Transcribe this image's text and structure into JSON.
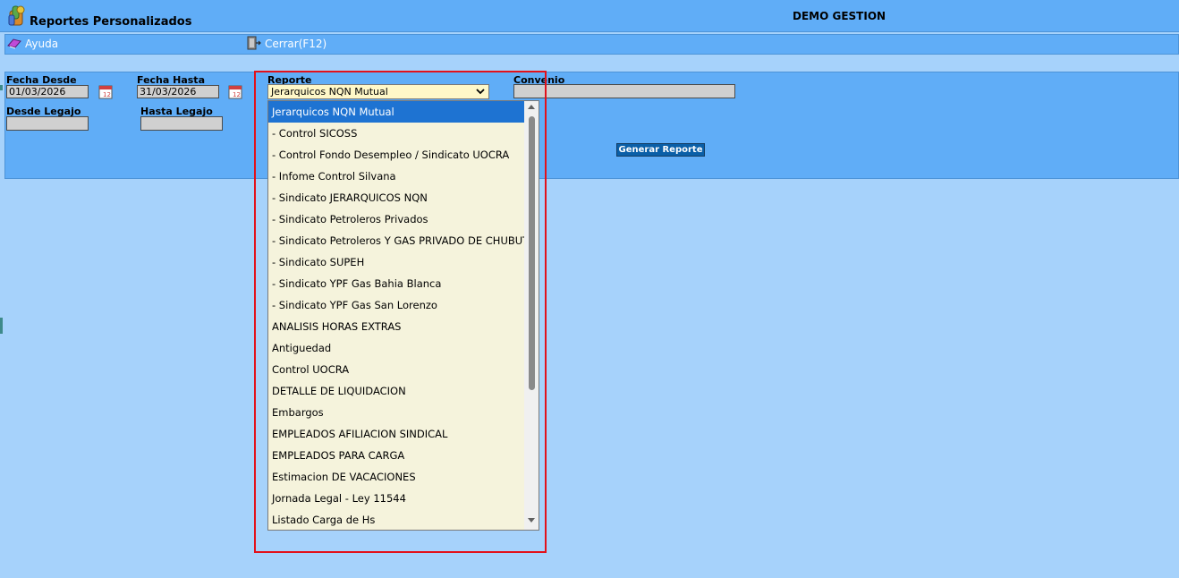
{
  "header": {
    "title": "Reportes Personalizados",
    "company": "DEMO GESTION"
  },
  "menu": {
    "ayuda": "Ayuda",
    "cerrar": "Cerrar(F12)"
  },
  "form": {
    "fecha_desde_label": "Fecha Desde",
    "fecha_desde_value": "01/03/2026",
    "fecha_hasta_label": "Fecha Hasta",
    "fecha_hasta_value": "31/03/2026",
    "reporte_label": "Reporte",
    "reporte_value": "Jerarquicos NQN Mutual",
    "convenio_label": "Convenio",
    "convenio_value": "",
    "desde_legajo_label": "Desde Legajo",
    "desde_legajo_value": "",
    "hasta_legajo_label": "Hasta Legajo",
    "hasta_legajo_value": "",
    "generar_label": "Generar Reporte"
  },
  "dropdown": {
    "selected_index": 0,
    "options": [
      "Jerarquicos NQN Mutual",
      "- Control SICOSS",
      "- Control Fondo Desempleo / Sindicato UOCRA",
      "- Infome Control Silvana",
      "- Sindicato JERARQUICOS NQN",
      "- Sindicato Petroleros Privados",
      "- Sindicato Petroleros Y GAS PRIVADO DE CHUBUT",
      "- Sindicato SUPEH",
      "- Sindicato YPF Gas Bahia Blanca",
      "- Sindicato YPF Gas San Lorenzo",
      "ANALISIS HORAS EXTRAS",
      "Antiguedad",
      "Control UOCRA",
      "DETALLE DE LIQUIDACION",
      "Embargos",
      "EMPLEADOS AFILIACION SINDICAL",
      "EMPLEADOS PARA CARGA",
      "Estimacion DE VACACIONES",
      "Jornada Legal - Ley 11544",
      "Listado Carga de Hs"
    ]
  },
  "colors": {
    "background": "#a6d2fb",
    "bar": "#60adf7",
    "selected": "#1e73d2",
    "highlight": "#e2111b"
  },
  "icons": {
    "app": "app-logo-icon",
    "help": "help-book-icon",
    "close": "exit-door-icon",
    "calendar": "calendar-icon"
  }
}
